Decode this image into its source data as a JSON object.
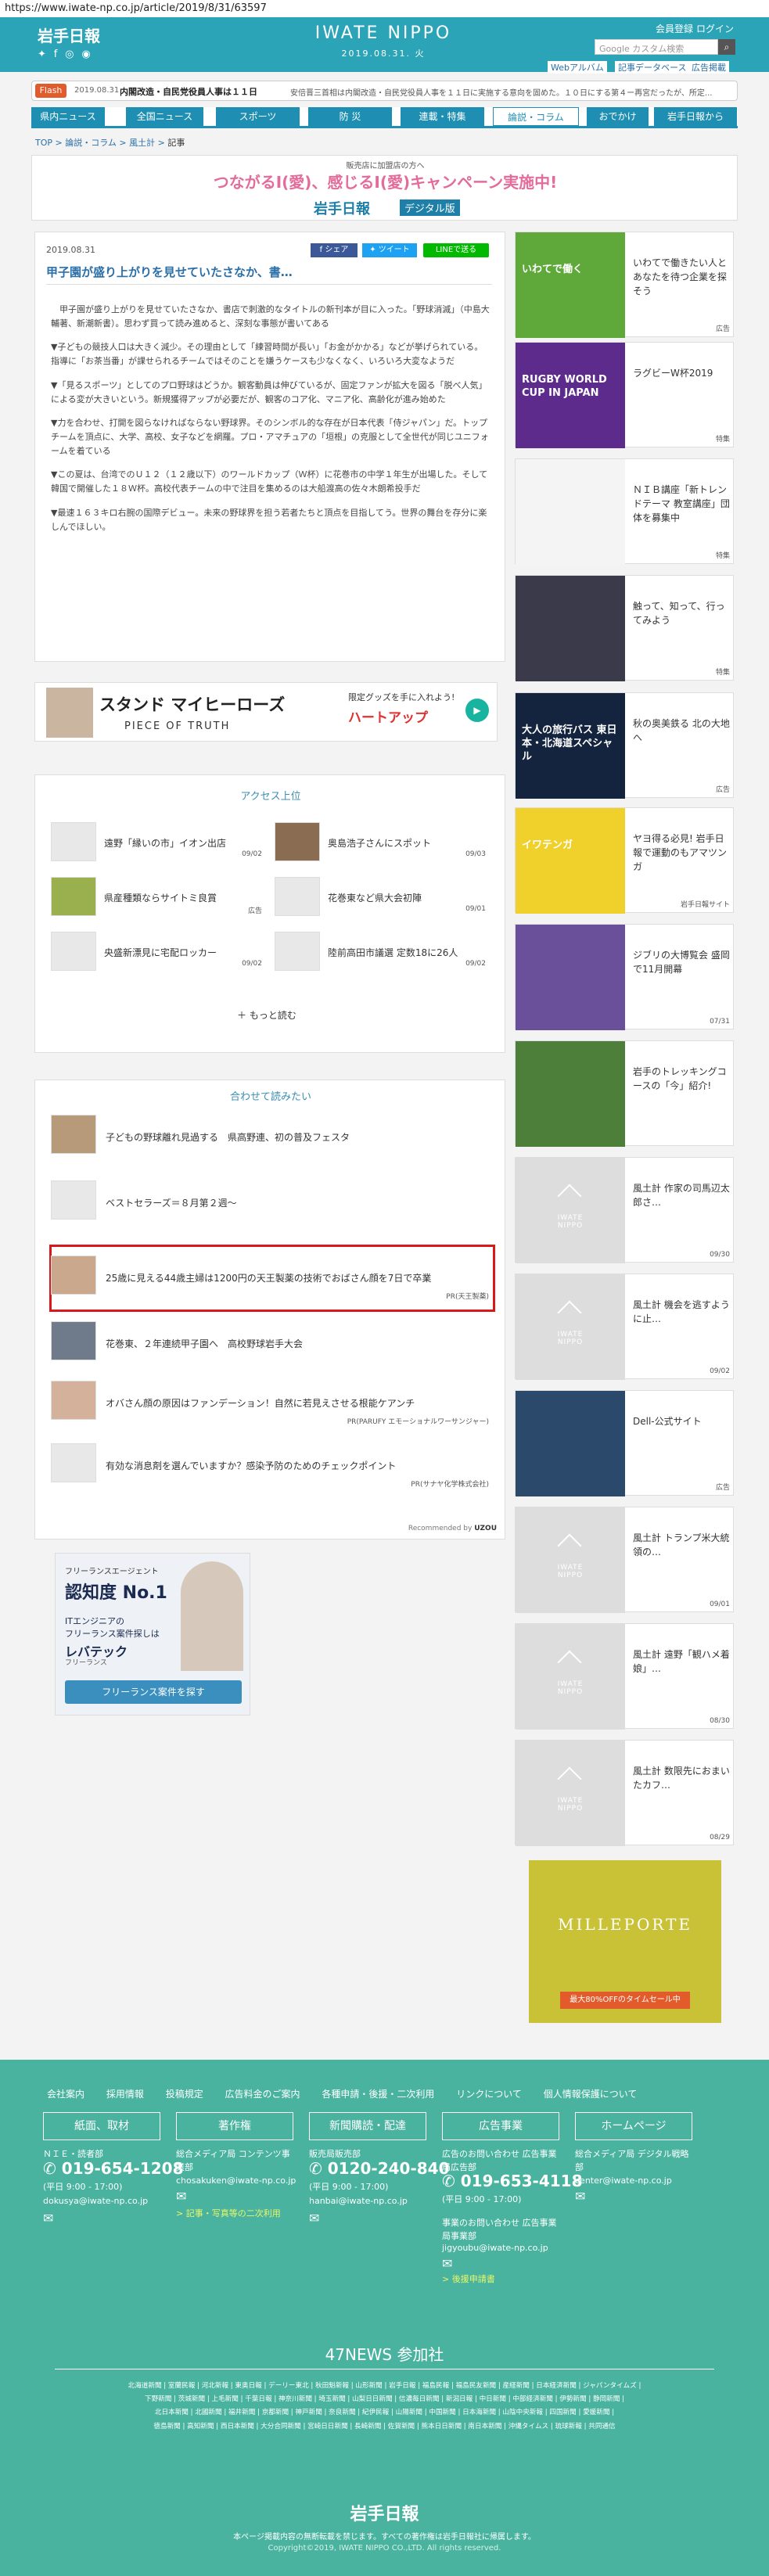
{
  "url": "https://www.iwate-np.co.jp/article/2019/8/31/63597",
  "header": {
    "logo_left": "岩手日報",
    "logo_center": "IWATE NIPPO",
    "date": "2019.08.31. 火",
    "member_register": "会員登録",
    "login": "ログイン",
    "search_placeholder": "Google カスタム検索",
    "sub_links": [
      "Webアルバム",
      "記事データベース",
      "広告掲載"
    ]
  },
  "ticker": {
    "flash_label": "Flash",
    "time": "2019.08.31",
    "headline": "内閣改造・自民党役員人事は１１日",
    "body": "安倍晋三首相は内閣改造・自民党役員人事を１１日に実施する意向を固めた。１０日にする第４ー再宮だったが、所定..."
  },
  "nav": [
    "県内ニュース",
    "全国ニュース",
    "スポーツ",
    "防 災",
    "連載・特集",
    "論説・コラム",
    "おでかけ",
    "岩手日報から"
  ],
  "breadcrumb": [
    "TOP",
    "論説・コラム",
    "風土計",
    "記事"
  ],
  "banner_top": {
    "small": "販売店に加盟店の方へ",
    "main": "つながるI(愛)、感じるI(愛)キャンペーン実施中!",
    "logo": "岩手日報",
    "tag": "デジタル版"
  },
  "article": {
    "date": "2019.08.31",
    "share_fb": "シェア",
    "share_tw": "ツイート",
    "share_line": "LINEで送る",
    "title": "甲子園が盛り上がりを見せていたさなか、書…",
    "paragraphs": [
      "甲子園が盛り上がりを見せていたさなか、書店で刺激的なタイトルの新刊本が目に入った。「野球消滅」（中島大輔著、新潮新書）。思わず買って読み進めると、深刻な事態が書いてある",
      "▼子どもの競技人口は大きく減少。その理由として「練習時間が長い」「お金がかかる」などが挙げられている。指導に「お茶当番」が課せられるチームではそのことを嫌うケースも少なくなく、いろいろ大変なようだ",
      "▼「見るスポーツ」としてのプロ野球はどうか。観客動員は伸びているが、固定ファンが拡大を図る「脱べ人気」による変が大きいという。新規獲得アップが必要だが、観客のコア化、マニア化、高齢化が進み始めた",
      "▼力を合わせ、打開を図らなければならない野球界。そのシンボル的な存在が日本代表「侍ジャパン」だ。トップチームを頂点に、大学、高校、女子などを網羅。プロ・アマチュアの「垣根」の克服として全世代が同じユニフォームを着ている",
      "▼この夏は、台湾でのＵ１２（１２歳以下）のワールドカップ（Ｗ杯）に花巻市の中学１年生が出場した。そして韓国で開催した１８Ｗ杯。高校代表チームの中で注目を集めるのは大船渡高の佐々木朗希投手だ",
      "▼最速１６３キロ右腕の国際デビュー。未来の野球界を担う若者たちと頂点を目指してう。世界の舞台を存分に楽しんでほしい。"
    ]
  },
  "ad_mid": {
    "title": "スタンド マイヒーローズ",
    "subtitle": "PIECE OF TRUTH",
    "tag1": "限定グッズを手に入れよう!",
    "tag2": "ハートアップ"
  },
  "access": {
    "heading": "アクセス上位",
    "items": [
      {
        "title": "遠野「縁いの市」イオン出店",
        "date": "09/02"
      },
      {
        "title": "奥島浩子さんにスポット",
        "date": "09/03"
      },
      {
        "title": "県産種類ならサイトミ良賞",
        "date": "広告"
      },
      {
        "title": "花巻東など県大会初陣",
        "date": "09/01"
      },
      {
        "title": "央盛新漂見に宅配ロッカー",
        "date": "09/02"
      },
      {
        "title": "陸前高田市議選 定数18に26人",
        "date": "09/02"
      }
    ],
    "more": "もっと読む"
  },
  "related": {
    "heading": "合わせて読みたい",
    "items": [
      {
        "title": "子どもの野球離れ見過する　県高野連、初の普及フェスタ",
        "pr": ""
      },
      {
        "title": "ベストセラーズ＝８月第２週～",
        "pr": ""
      },
      {
        "title": "25歳に見える44歳主婦は1200円の天王製薬の技術でおばさん顔を7日で卒業",
        "pr": "PR(天王製薬)"
      },
      {
        "title": "花巻東、２年連続甲子園へ　高校野球岩手大会",
        "pr": ""
      },
      {
        "title": "オバさん顔の原因はファンデーション！自然に若見えさせる根能ケアンチ",
        "pr": "PR(PARUFY エモーショナルワーサンジャー)"
      },
      {
        "title": "有効な消息剤を選んでいますか？感染予防のためのチェックポイント",
        "pr": "PR(サナヤ化学株式会社)"
      }
    ],
    "footer": "Recommended by",
    "brand": "UZOU"
  },
  "ad_left": {
    "small": "フリーランスエージェント",
    "big": "認知度 No.1",
    "line1": "ITエンジニアの",
    "line2": "フリーランス案件探しは",
    "brand": "レバテック",
    "brand_sub": "フリーランス",
    "cta": "フリーランス案件を探す"
  },
  "sidebar": [
    {
      "text": "いわてで働きたい人とあなたを待つ企業を探そう",
      "tag": "広告",
      "img": "いわてで働く"
    },
    {
      "text": "ラグビーW杯2019",
      "tag": "特集",
      "img": "RUGBY WORLD CUP IN JAPAN"
    },
    {
      "text": "ＮＩＢ講座「新トレンドテーマ 教室講座」団体を募集中",
      "tag": "特集",
      "img": ""
    },
    {
      "text": "触って、知って、行ってみよう",
      "tag": "特集",
      "img": ""
    },
    {
      "text": "秋の奥美鉄る 北の大地へ",
      "tag": "広告",
      "img": "大人の旅行バス 東日本・北海道スペシャル"
    },
    {
      "text": "ヤヨ得る必見! 岩手日報で運動のもアマツンガ",
      "tag": "岩手日報サイト",
      "img": "イワテンガ"
    },
    {
      "text": "ジブリの大博覧会 盛岡で11月開幕",
      "tag": "07/31",
      "img": ""
    },
    {
      "text": "岩手のトレッキングコースの「今」紹介!",
      "tag": "",
      "img": ""
    },
    {
      "text": "風土計 作家の司馬辺太郎さ…",
      "tag": "09/30",
      "img": "noimg"
    },
    {
      "text": "風土計 機会を逃すように止…",
      "tag": "09/02",
      "img": "noimg"
    },
    {
      "text": "Dell-公式サイト",
      "tag": "広告",
      "img": "dell"
    },
    {
      "text": "風土計 トランプ米大統領の…",
      "tag": "09/01",
      "img": "noimg"
    },
    {
      "text": "風土計 遠野「観ハメ着娘」…",
      "tag": "08/30",
      "img": "noimg"
    },
    {
      "text": "風土計 数限先におまいたカフ…",
      "tag": "08/29",
      "img": "noimg"
    }
  ],
  "ad_right": {
    "brand": "MILLEPORTE",
    "sub": "最大80%OFFのタイムセール中"
  },
  "noimg_logo": "IWATE NIPPO",
  "footer": {
    "links": [
      "会社案内",
      "採用情報",
      "投稿規定",
      "広告料金のご案内",
      "各種申請・後援・二次利用",
      "リンクについて",
      "個人情報保護について"
    ],
    "boxes": [
      "紙面、取材",
      "著作権",
      "新聞購読・配達",
      "広告事業",
      "ホームページ"
    ],
    "col1": {
      "dept": "ＮＩＥ・読者部",
      "tel": "019-654-1208",
      "hours": "(平日 9:00 - 17:00)",
      "mail": "dokusya@iwate-np.co.jp"
    },
    "col2": {
      "dept": "総合メディア局 コンテンツ事業部",
      "mail": "chosakuken@iwate-np.co.jp",
      "note": "> 記事・写真等の二次利用"
    },
    "col3": {
      "dept": "販売局販売部",
      "tel": "0120-240-840",
      "hours": "(平日 9:00 - 17:00)",
      "mail": "hanbai@iwate-np.co.jp"
    },
    "col4": {
      "dept": "広告のお問い合わせ 広告事業局広告部",
      "tel": "019-653-4118",
      "hours": "(平日 9:00 - 17:00)",
      "dept2": "事業のお問い合わせ 広告事業局事業部",
      "mail": "jigyoubu@iwate-np.co.jp",
      "note": "> 後援申請書"
    },
    "col5": {
      "dept": "総合メディア局 デジタル戦略部",
      "mail": "center@iwate-np.co.jp"
    },
    "news47": "47NEWS 参加社",
    "news_lines": [
      "北海道新聞 | 室蘭民報 | 河北新報 | 東奥日報 | デーリー東北 | 秋田魁新報 | 山形新聞 | 岩手日報 | 福島民報 | 福島民友新聞 | 産経新聞 | 日本経済新聞 | ジャパンタイムズ |",
      "下野新聞 | 茨城新聞 | 上毛新聞 | 千葉日報 | 神奈川新聞 | 埼玉新聞 | 山梨日日新聞 | 信濃毎日新聞 | 新潟日報 | 中日新聞 | 中部経済新聞 | 伊勢新聞 | 静岡新聞 |",
      "北日本新聞 | 北國新聞 | 福井新聞 | 京都新聞 | 神戸新聞 | 奈良新聞 | 紀伊民報 | 山陽新聞 | 中国新聞 | 日本海新聞 | 山陰中央新報 | 四国新聞 | 愛媛新聞 |",
      "徳島新聞 | 高知新聞 | 西日本新聞 | 大分合同新聞 | 宮崎日日新聞 | 長崎新聞 | 佐賀新聞 | 熊本日日新聞 | 南日本新聞 | 沖縄タイムス | 琉球新報 | 共同通信"
    ],
    "logo": "岩手日報",
    "notice": "本ページ掲載内容の無断転載を禁じます。すべての著作権は岩手日報社に帰属します。",
    "copyright": "Copyright©2019, IWATE NIPPO CO.,LTD. All rights reserved."
  }
}
